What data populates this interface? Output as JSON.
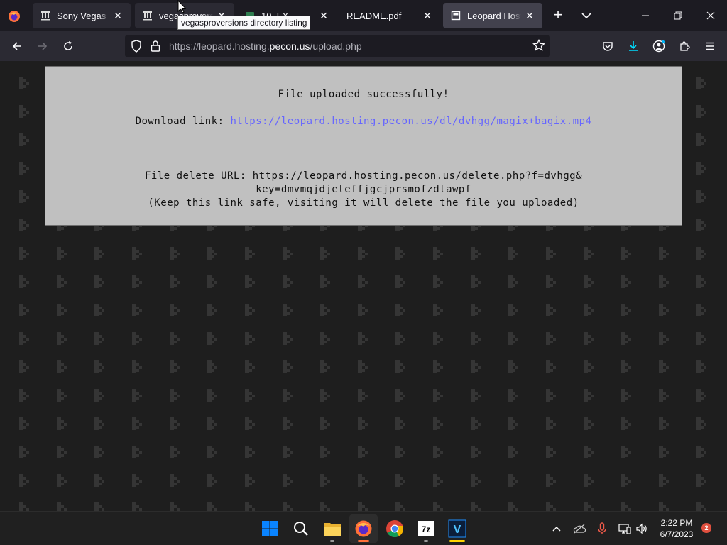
{
  "browser": {
    "tabs": [
      {
        "label": "Sony Vegas Pro Versions"
      },
      {
        "label": "vegasproversions"
      },
      {
        "label": "10_FX"
      },
      {
        "label": "README.pdf"
      },
      {
        "label": "Leopard Hosting"
      }
    ],
    "tooltip": "vegasproversions directory listing",
    "url_prefix": "https://leopard.hosting.",
    "url_domain": "pecon.us",
    "url_path": "/upload.php"
  },
  "page": {
    "success_message": "File uploaded successfully!",
    "download_label": "Download link: ",
    "download_url": "https://leopard.hosting.pecon.us/dl/dvhgg/magix+bagix.mp4",
    "delete_line1": "File delete URL: https://leopard.hosting.pecon.us/delete.php?f=dvhgg&",
    "delete_line2": "key=dmvmqjdjeteffjgcjprsmofzdtawpf",
    "delete_note": "(Keep this link safe, visiting it will delete the file you uploaded)"
  },
  "taskbar": {
    "apps": [
      "start",
      "search",
      "file-explorer",
      "firefox",
      "chrome",
      "7zip",
      "vegas"
    ],
    "time": "2:22 PM",
    "date": "6/7/2023",
    "notification_count": "2"
  },
  "colors": {
    "link": "#6666ff",
    "panel": "#c0c0c0",
    "firefox_accent": "#ff7139"
  }
}
